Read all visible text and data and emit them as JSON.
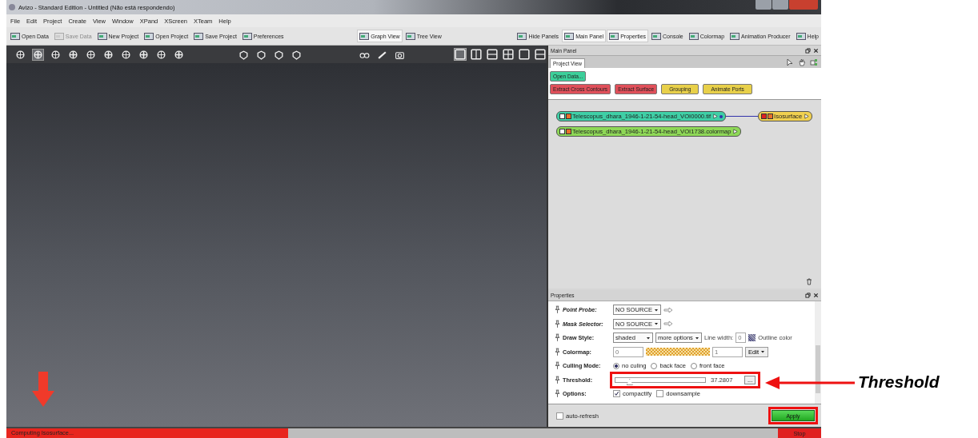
{
  "window": {
    "title": "Avizo - Standard Edition - Untitled (Não está respondendo)"
  },
  "menu": [
    "File",
    "Edit",
    "Project",
    "Create",
    "View",
    "Window",
    "XPand",
    "XScreen",
    "XTeam",
    "Help"
  ],
  "toolbar": {
    "left": [
      {
        "label": "Open Data",
        "disabled": false
      },
      {
        "label": "Save Data",
        "disabled": true
      },
      {
        "label": "New Project",
        "disabled": false
      },
      {
        "label": "Open Project",
        "disabled": false
      },
      {
        "label": "Save Project",
        "disabled": false
      },
      {
        "label": "Preferences",
        "disabled": false
      }
    ],
    "middle": [
      {
        "label": "Graph View",
        "selected": true
      },
      {
        "label": "Tree View",
        "selected": false
      }
    ],
    "right": [
      {
        "label": "Hide Panels",
        "selected": false
      },
      {
        "label": "Main Panel",
        "selected": true
      },
      {
        "label": "Properties",
        "selected": true
      },
      {
        "label": "Console",
        "selected": false
      },
      {
        "label": "Colormap",
        "selected": false
      },
      {
        "label": "Animation Producer",
        "selected": false
      },
      {
        "label": "Help",
        "selected": false
      }
    ]
  },
  "viewer_tools": [
    {
      "selected": false
    },
    {
      "selected": true
    },
    {
      "selected": false
    },
    {
      "selected": false
    },
    {
      "selected": false
    },
    {
      "selected": false
    },
    {
      "selected": false
    },
    {
      "selected": false
    },
    {
      "selected": false
    },
    {
      "selected": false
    }
  ],
  "layout_buttons": [
    {
      "selected": true
    },
    {
      "selected": false
    },
    {
      "selected": false
    },
    {
      "selected": false
    },
    {
      "selected": false
    },
    {
      "selected": false
    }
  ],
  "main_panel": {
    "title": "Main Panel",
    "tab": "Project View",
    "buttons": [
      {
        "label": "Open Data...",
        "color": "#3ccf9a"
      },
      {
        "label": "Extract Cross Contours",
        "color": "#e0505a"
      },
      {
        "label": "Extract Surface",
        "color": "#e0505a"
      },
      {
        "label": "Grouping",
        "color": "#e8d04a"
      },
      {
        "label": "Animate Ports",
        "color": "#e8d04a"
      }
    ],
    "nodes": [
      {
        "label": "Telescopus_dhara_1946-1-21-54-head_VOI0000.tif",
        "color": "#3fcfa6",
        "connected": true
      },
      {
        "label": "Telescopus_dhara_1946-1-21-54-head_VOI1738.colormap",
        "color": "#8ed857",
        "connected": false
      }
    ],
    "output_node": {
      "label": "Isosurface",
      "color": "#f0d050"
    }
  },
  "properties": {
    "title": "Properties",
    "rows": [
      {
        "kind": "port",
        "label": "Point Probe:",
        "value": "NO SOURCE"
      },
      {
        "kind": "port",
        "label": "Mask Selector:",
        "value": "NO SOURCE"
      },
      {
        "kind": "draw_style",
        "label": "Draw Style:",
        "value": "shaded",
        "options_button": "more options",
        "width_label": "Line width:",
        "width_value": "0",
        "color_label": "Outline color"
      },
      {
        "kind": "colormap",
        "label": "Colormap:",
        "min": "0",
        "max": "1",
        "button": "Edit"
      },
      {
        "kind": "radio",
        "label": "Culling Mode:",
        "options": [
          {
            "label": "no culing",
            "selected": true
          },
          {
            "label": "back face",
            "selected": false
          },
          {
            "label": "front face",
            "selected": false
          }
        ]
      },
      {
        "kind": "slider",
        "label": "Threshold:",
        "level": 0.15,
        "value": "37.2807",
        "button": "..."
      },
      {
        "kind": "checks",
        "label": "Options:",
        "options": [
          {
            "label": "compactify",
            "checked": true
          },
          {
            "label": "downsample",
            "checked": false
          }
        ]
      }
    ],
    "auto_refresh": {
      "label": "auto-refresh",
      "checked": false
    },
    "apply": "Apply"
  },
  "status_bar": {
    "text": "Computing Isosurface...",
    "level": 0.365,
    "stop": "Stop"
  },
  "annotations": {
    "label": "Threshold"
  }
}
